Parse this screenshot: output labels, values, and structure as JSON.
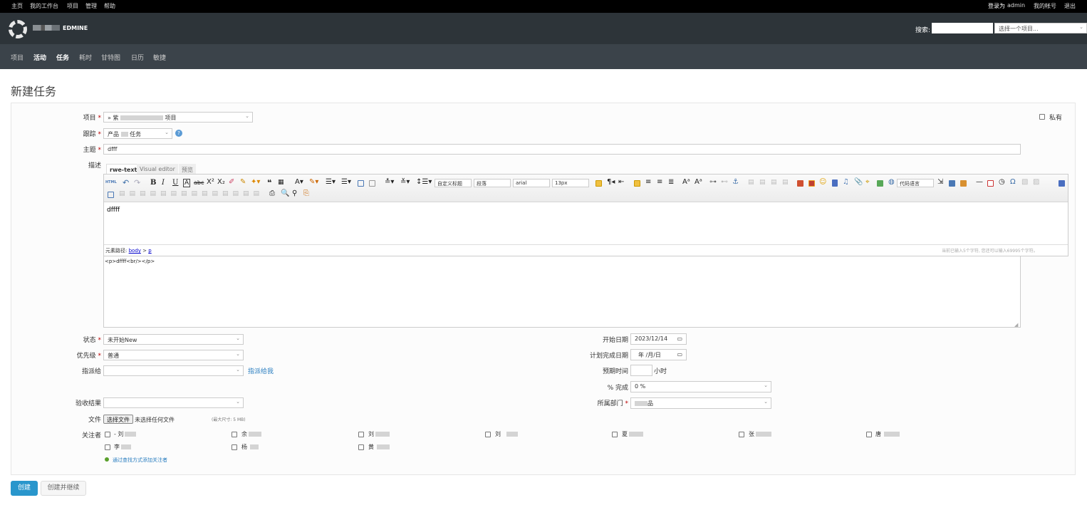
{
  "top_menu": {
    "left": [
      "主页",
      "我的工作台",
      "项目",
      "管理",
      "帮助"
    ],
    "logged_in_prefix": "登录为",
    "logged_in_user": "admin",
    "my_account": "我的帐号",
    "logout": "退出"
  },
  "header": {
    "logo_text": "EDMINE",
    "search_label": "搜索:",
    "search_placeholder": "",
    "project_jump": "选择一个项目..."
  },
  "main_menu": [
    "项目",
    "活动",
    "任务",
    "耗时",
    "甘特图",
    "日历",
    "敏捷"
  ],
  "page_title": "新建任务",
  "form": {
    "project_label": "项目",
    "project_value_prefix": "» 紫",
    "project_value_suffix": "项目",
    "private_label": "私有",
    "tracker_label": "跟踪",
    "tracker_value_prefix": "产品",
    "tracker_value_suffix": "任务",
    "subject_label": "主题",
    "subject_value": "dfff",
    "description_label": "描述",
    "editor_tabs": [
      "rwe-text",
      "Visual editor",
      "预览"
    ],
    "toolbar": {
      "html": "HTML",
      "custom_title": "自定义标题",
      "paragraph": "段落",
      "font": "arial",
      "size": "13px",
      "code_language": "代码语言"
    },
    "editor_content": "dffff",
    "path_label": "元素路径:",
    "path_body": "body",
    "path_sep": ">",
    "path_p": "p",
    "char_count": "当前已输入5个字符, 您还可以输入69995个字符。",
    "source": "<p>dffff<br/></p>",
    "status_label": "状态",
    "status_value": "未开始New",
    "priority_label": "优先级",
    "priority_value": "普通",
    "assignee_label": "指派给",
    "assignee_value": "",
    "assign_to_me": "指派给我",
    "acceptance_label": "验收结果",
    "acceptance_value": "",
    "start_date_label": "开始日期",
    "start_date_value": "2023/12/14",
    "due_date_label": "计划完成日期",
    "due_date_value": "年 /月/日",
    "estimated_label": "预期时间",
    "estimated_value": "",
    "hours": "小时",
    "done_label": "% 完成",
    "done_value": "0 %",
    "department_label": "所属部门",
    "department_value": "品",
    "file_label": "文件",
    "choose_file": "选择文件",
    "no_file": "未选择任何文件",
    "max_size": "(最大尺寸: 5 MB)",
    "watchers_label": "关注者",
    "watchers": [
      "- 刘",
      "余",
      "刘",
      "刘",
      "夏",
      "张",
      "唐",
      "李",
      "杨",
      "黄"
    ],
    "add_watchers": "通过查找方式添加关注者"
  },
  "buttons": {
    "create": "创建",
    "create_continue": "创建并继续"
  },
  "colors": {
    "top_bar": "#000000",
    "header": "#2d3439",
    "main_menu": "#3b434a",
    "primary_button": "#2996cc",
    "link": "#2a7ec0"
  }
}
